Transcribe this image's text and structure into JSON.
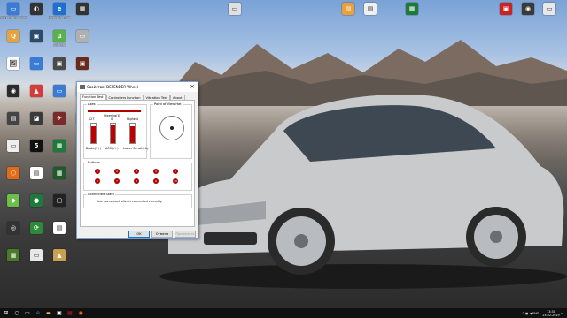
{
  "desktop_icons_left": [
    {
      "label": "Этот компьютер",
      "color": "#3a7bd5",
      "glyph": "▭"
    },
    {
      "label": "",
      "color": "#e9a23b",
      "glyph": "Q"
    },
    {
      "label": "",
      "color": "#ffffff",
      "glyph": "🖼"
    },
    {
      "label": "",
      "color": "#2b2b2b",
      "glyph": "◉"
    },
    {
      "label": "",
      "color": "#444444",
      "glyph": "▤"
    },
    {
      "label": "",
      "color": "#eeeeee",
      "glyph": "▭"
    },
    {
      "label": "",
      "color": "#e26b1a",
      "glyph": "⬡"
    },
    {
      "label": "",
      "color": "#6cc04a",
      "glyph": "◆"
    },
    {
      "label": "",
      "color": "#333333",
      "glyph": "◎"
    },
    {
      "label": "",
      "color": "#4a7a2a",
      "glyph": "▦"
    },
    {
      "label": "",
      "color": "#333333",
      "glyph": "◐"
    },
    {
      "label": "",
      "color": "#2e4a6b",
      "glyph": "▣"
    },
    {
      "label": "",
      "color": "#3a7bd5",
      "glyph": "▭"
    },
    {
      "label": "",
      "color": "#d63a3a",
      "glyph": "▲"
    },
    {
      "label": "",
      "color": "#3a3a3a",
      "glyph": "◪"
    },
    {
      "label": "",
      "color": "#111111",
      "glyph": "5"
    },
    {
      "label": "",
      "color": "#ffffff",
      "glyph": "▤"
    },
    {
      "label": "",
      "color": "#1e7a3a",
      "glyph": "●"
    },
    {
      "label": "",
      "color": "#2d8a3a",
      "glyph": "⟳"
    },
    {
      "label": "",
      "color": "#e8e8e8",
      "glyph": "▭"
    },
    {
      "label": "Microsoft Edge",
      "color": "#1f6fd1",
      "glyph": "e"
    },
    {
      "label": "uTorrent",
      "color": "#5ab04a",
      "glyph": "µ"
    },
    {
      "label": "",
      "color": "#4a4a4a",
      "glyph": "▣"
    },
    {
      "label": "",
      "color": "#3a7bd5",
      "glyph": "▭"
    },
    {
      "label": "",
      "color": "#7a2a2a",
      "glyph": "✈"
    },
    {
      "label": "",
      "color": "#1e7a3a",
      "glyph": "▦"
    },
    {
      "label": "",
      "color": "#1e5a2a",
      "glyph": "▦"
    },
    {
      "label": "",
      "color": "#222222",
      "glyph": "▢"
    },
    {
      "label": "",
      "color": "#ffffff",
      "glyph": "▤"
    },
    {
      "label": "",
      "color": "#c8a050",
      "glyph": "▲"
    },
    {
      "label": "",
      "color": "#333333",
      "glyph": "▦"
    },
    {
      "label": "",
      "color": "#b0b0b0",
      "glyph": "▭"
    },
    {
      "label": "",
      "color": "#6a2a1a",
      "glyph": "▣"
    },
    {
      "label": "",
      "color": "#cc2222",
      "glyph": "★"
    },
    {
      "label": "",
      "color": "#5a5a5a",
      "glyph": "▭"
    }
  ],
  "desktop_icons_top": [
    {
      "label": "",
      "color": "#e0e0e0",
      "glyph": "▭"
    },
    {
      "label": "",
      "color": "#e9a23b",
      "glyph": "▤"
    },
    {
      "label": "",
      "color": "#f0f0f0",
      "glyph": "▤"
    },
    {
      "label": "",
      "color": "#1e7a3a",
      "glyph": "▦"
    },
    {
      "label": "",
      "color": "#cc2222",
      "glyph": "▣"
    },
    {
      "label": "",
      "color": "#3a3a3a",
      "glyph": "◉"
    },
    {
      "label": "",
      "color": "#e8e8e8",
      "glyph": "▭"
    }
  ],
  "dialog": {
    "title": "Свойства: DEFENDER Wheel",
    "close": "✕",
    "tabs": [
      "Function Test",
      "Controllers Function",
      "Vibration Test",
      "About"
    ],
    "axes_label": "Axes",
    "axis_labels": [
      "Steering(X)",
      "Highest",
      "127",
      "0",
      "Brake(Y+)",
      "ACC(Y+)",
      "Lower Sensitivity"
    ],
    "pov_label": "Point of View Hat",
    "buttons_label": "Buttons",
    "button_numbers": [
      "1",
      "2",
      "3",
      "4",
      "5",
      "6",
      "7",
      "8",
      "9",
      "10"
    ],
    "state_label": "Connected State",
    "state_text": "Your game controller is connected correctly.",
    "ok": "OK",
    "cancel": "Отмена",
    "apply": "Применить",
    "vbars": [
      0.85,
      0.9,
      0.85
    ]
  },
  "taskbar": {
    "start_icon": "windows-icon",
    "lang": "ENG",
    "time": "13:30",
    "date": "24.02.2019"
  }
}
